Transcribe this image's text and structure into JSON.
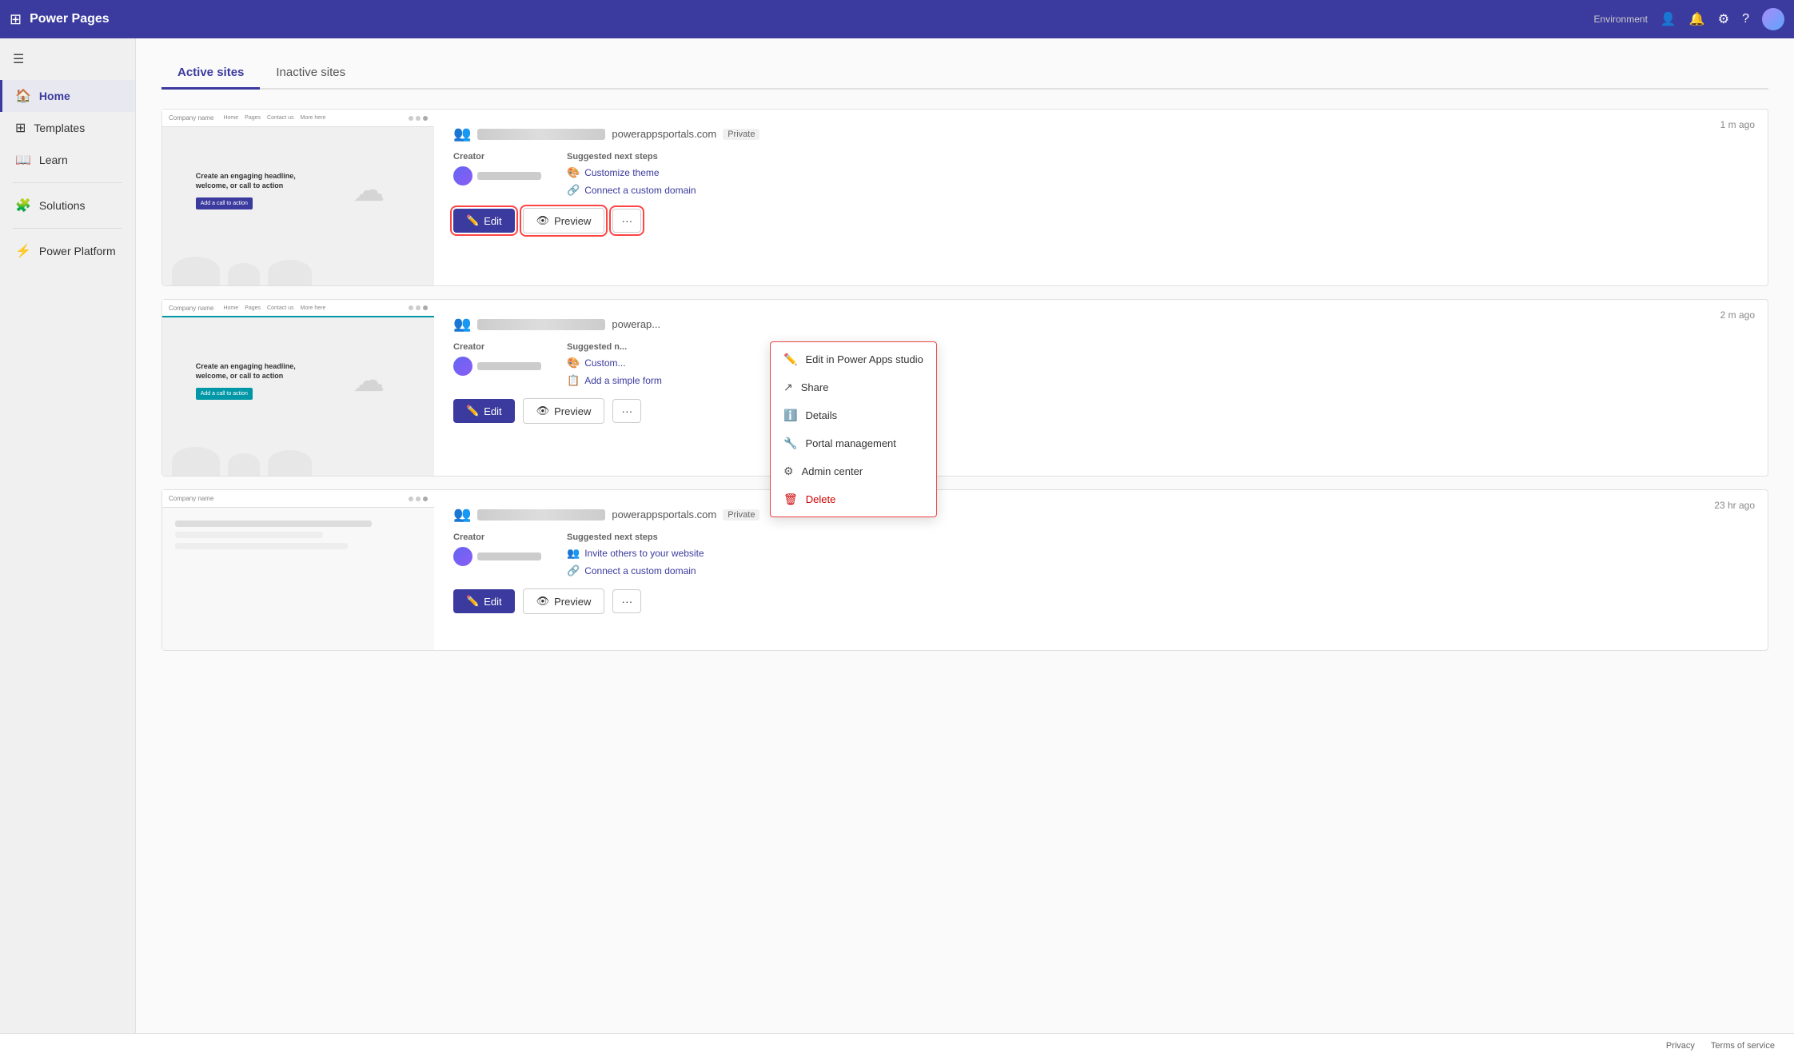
{
  "app": {
    "title": "Power Pages",
    "environment": "Environment"
  },
  "topbar": {
    "grid_label": "⊞",
    "notifications_icon": "🔔",
    "settings_icon": "⚙",
    "help_icon": "?",
    "env_label": "Environment"
  },
  "sidebar": {
    "hamburger": "☰",
    "items": [
      {
        "id": "home",
        "label": "Home",
        "icon": "🏠",
        "active": true
      },
      {
        "id": "templates",
        "label": "Templates",
        "icon": "⊞"
      },
      {
        "id": "learn",
        "label": "Learn",
        "icon": "📖"
      },
      {
        "id": "solutions",
        "label": "Solutions",
        "icon": "🧩"
      },
      {
        "id": "power-platform",
        "label": "Power Platform",
        "icon": "⚡"
      }
    ]
  },
  "main": {
    "tabs": [
      {
        "id": "active",
        "label": "Active sites",
        "active": true
      },
      {
        "id": "inactive",
        "label": "Inactive sites",
        "active": false
      }
    ],
    "sites": [
      {
        "id": "site1",
        "timestamp": "1 m ago",
        "url": "powerappsportals.com",
        "visibility": "Private",
        "creator_label": "Creator",
        "next_steps_label": "Suggested next steps",
        "next_step_1": "Customize theme",
        "next_step_2": "Connect a custom domain",
        "edit_label": "Edit",
        "preview_label": "Preview",
        "more_label": "···",
        "show_dropdown": true
      },
      {
        "id": "site2",
        "timestamp": "2 m ago",
        "url": "powerap...",
        "visibility": "",
        "creator_label": "Creator",
        "next_steps_label": "Suggested n...",
        "next_step_1": "Custom...",
        "next_step_2": "Add a simple form",
        "edit_label": "Edit",
        "preview_label": "Preview",
        "more_label": "···",
        "show_dropdown": false
      },
      {
        "id": "site3",
        "timestamp": "23 hr ago",
        "url": "powerappsportals.com",
        "visibility": "Private",
        "creator_label": "Creator",
        "next_steps_label": "Suggested next steps",
        "next_step_1": "Invite others to your website",
        "next_step_2": "Connect a custom domain",
        "edit_label": "Edit",
        "preview_label": "Preview",
        "more_label": "···",
        "show_dropdown": false
      }
    ],
    "dropdown_menu": {
      "items": [
        {
          "id": "edit-studio",
          "label": "Edit in Power Apps studio",
          "icon": "✏️"
        },
        {
          "id": "share",
          "label": "Share",
          "icon": "↗"
        },
        {
          "id": "details",
          "label": "Details",
          "icon": "ℹ️"
        },
        {
          "id": "portal-mgmt",
          "label": "Portal management",
          "icon": "🔧"
        },
        {
          "id": "admin-center",
          "label": "Admin center",
          "icon": "⚙"
        },
        {
          "id": "delete",
          "label": "Delete",
          "icon": "🗑"
        }
      ]
    }
  },
  "footer": {
    "privacy_label": "Privacy",
    "tos_label": "Terms of service"
  }
}
